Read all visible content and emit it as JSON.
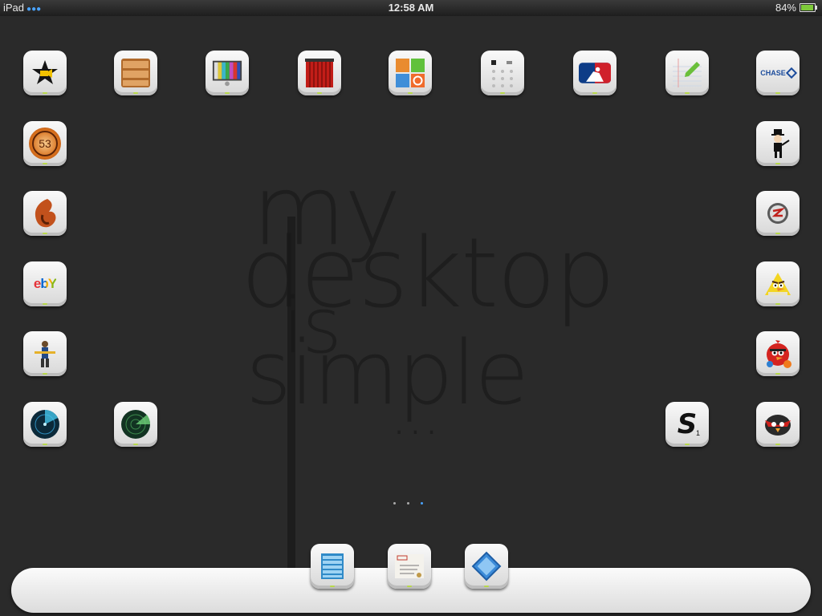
{
  "status": {
    "device": "iPad",
    "time": "12:58 AM",
    "battery": "84%",
    "battery_level": 0.84
  },
  "wallpaper": {
    "line1": "my",
    "line2": "desktop",
    "line3": "is",
    "line4": "simple",
    "line5": "..."
  },
  "icons": {
    "row1": [
      "imovie-icon",
      "bookshelf-icon",
      "tv-icon",
      "curtain-icon",
      "app-collection-icon",
      "dots-grid-icon",
      "mlb-icon",
      "notepad-icon",
      "chase-icon"
    ],
    "chase_label": "CHASE",
    "paper53_label": "53",
    "ebay_label": "ebY",
    "scrabble_label": "S",
    "scrabble_sub": "1"
  },
  "page_dots": 3,
  "active_page": 2,
  "colors": {
    "accent": "#4aa3ff",
    "indicator": "#b7d84b"
  }
}
